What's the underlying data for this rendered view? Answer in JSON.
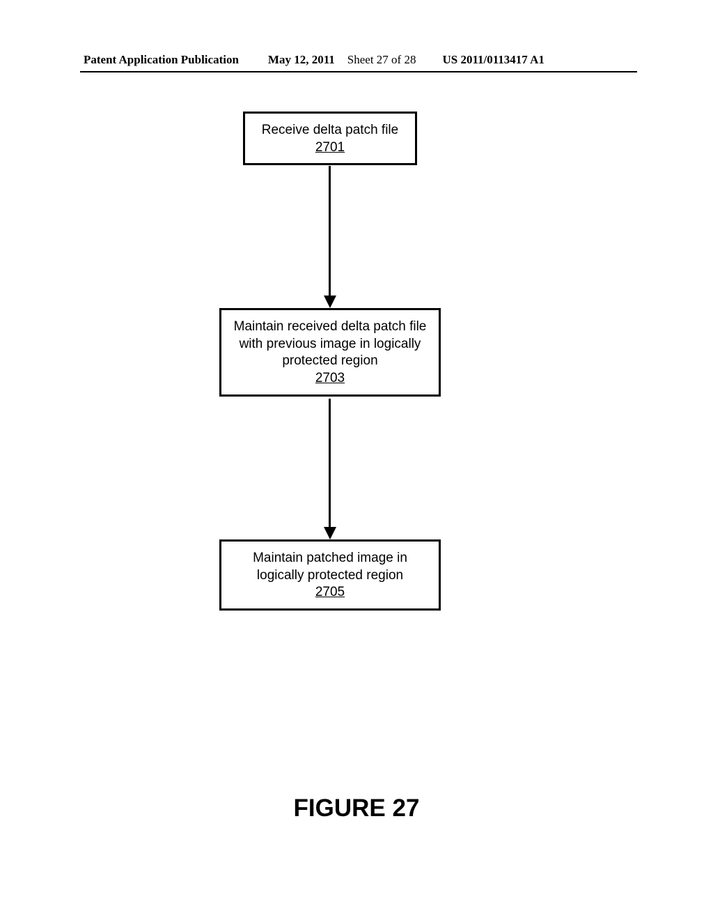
{
  "header": {
    "publication": "Patent Application Publication",
    "date": "May 12, 2011",
    "sheet": "Sheet 27 of 28",
    "docnum": "US 2011/0113417 A1"
  },
  "steps": [
    {
      "text": "Receive delta patch file",
      "ref": "2701"
    },
    {
      "text": "Maintain received delta patch file with previous image in logically protected region",
      "ref": "2703"
    },
    {
      "text": "Maintain patched image in logically protected region",
      "ref": "2705"
    }
  ],
  "figure_label": "FIGURE 27"
}
